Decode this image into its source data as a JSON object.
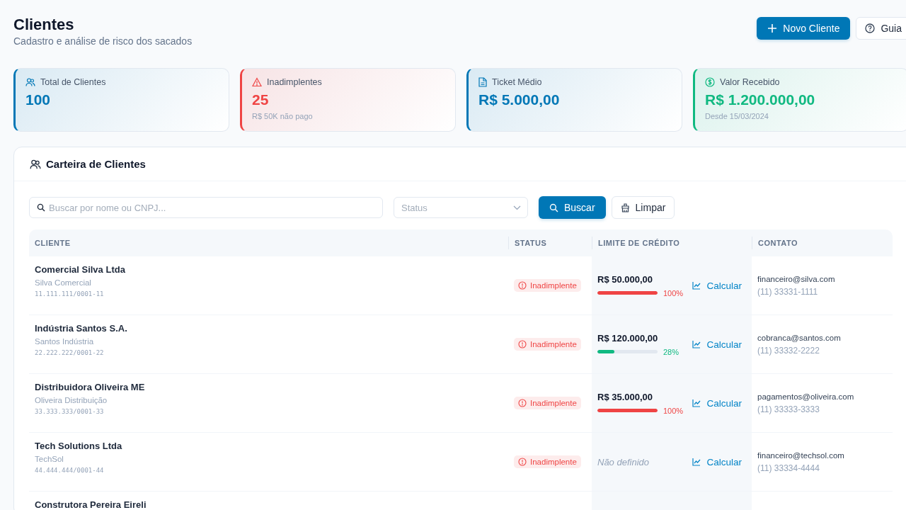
{
  "header": {
    "title": "Clientes",
    "subtitle": "Cadastro e análise de risco dos sacados",
    "buttons": [
      {
        "kind": "primary",
        "label": "Novo Cliente"
      },
      {
        "kind": "help",
        "label": "Guia"
      }
    ]
  },
  "stats": [
    {
      "kind": "users",
      "color": "#0077b6",
      "label": "Total de Clientes",
      "value": "100"
    },
    {
      "kind": "alert",
      "color": "#ef4444",
      "label": "Inadimplentes",
      "value": "25",
      "note": "R$ 50K não pago"
    },
    {
      "kind": "doc",
      "color": "#0077b6",
      "label": "Ticket Médio",
      "value": "R$ 5.000,00"
    },
    {
      "kind": "money",
      "color": "#10b981",
      "label": "Valor Recebido",
      "value": "R$ 1.200.000,00",
      "note": "Desde 15/03/2024"
    }
  ],
  "panel": {
    "title": "Carteira de Clientes",
    "search": {
      "placeholder": "Buscar por nome ou CNPJ..."
    },
    "status_filter": {
      "placeholder": "Status"
    },
    "search_button": "Buscar",
    "clear_button": "Limpar"
  },
  "table": {
    "columns": [
      "CLIENTE",
      "STATUS",
      "LIMITE DE CRÉDITO",
      "CONTATO"
    ],
    "rows": [
      {
        "name": "Comercial Silva Ltda",
        "trade_name": "Silva Comercial",
        "cnpj": "11.111.111/0001-11",
        "status": "Inadimplente",
        "limit": "R$ 50.000,00",
        "level": 1,
        "usage": "100%",
        "calc": "Calcular",
        "email": "financeiro@silva.com",
        "phone": "(11) 33331-1111"
      },
      {
        "name": "Indústria Santos S.A.",
        "trade_name": "Santos Indústria",
        "cnpj": "22.222.222/0001-22",
        "status": "Inadimplente",
        "limit": "R$ 120.000,00",
        "level": 0.28,
        "usage": "28%",
        "calc": "Calcular",
        "email": "cobranca@santos.com",
        "phone": "(11) 33332-2222"
      },
      {
        "name": "Distribuidora Oliveira ME",
        "trade_name": "Oliveira Distribuição",
        "cnpj": "33.333.333/0001-33",
        "status": "Inadimplente",
        "limit": "R$ 35.000,00",
        "level": 1,
        "usage": "100%",
        "calc": "Calcular",
        "email": "pagamentos@oliveira.com",
        "phone": "(11) 33333-3333"
      },
      {
        "name": "Tech Solutions Ltda",
        "trade_name": "TechSol",
        "cnpj": "44.444.444/0001-44",
        "status": "Inadimplente",
        "limit_empty": "Não definido",
        "calc": "Calcular",
        "email": "financeiro@techsol.com",
        "phone": "(11) 33334-4444"
      },
      {
        "name": "Construtora Pereira Eireli"
      }
    ]
  }
}
